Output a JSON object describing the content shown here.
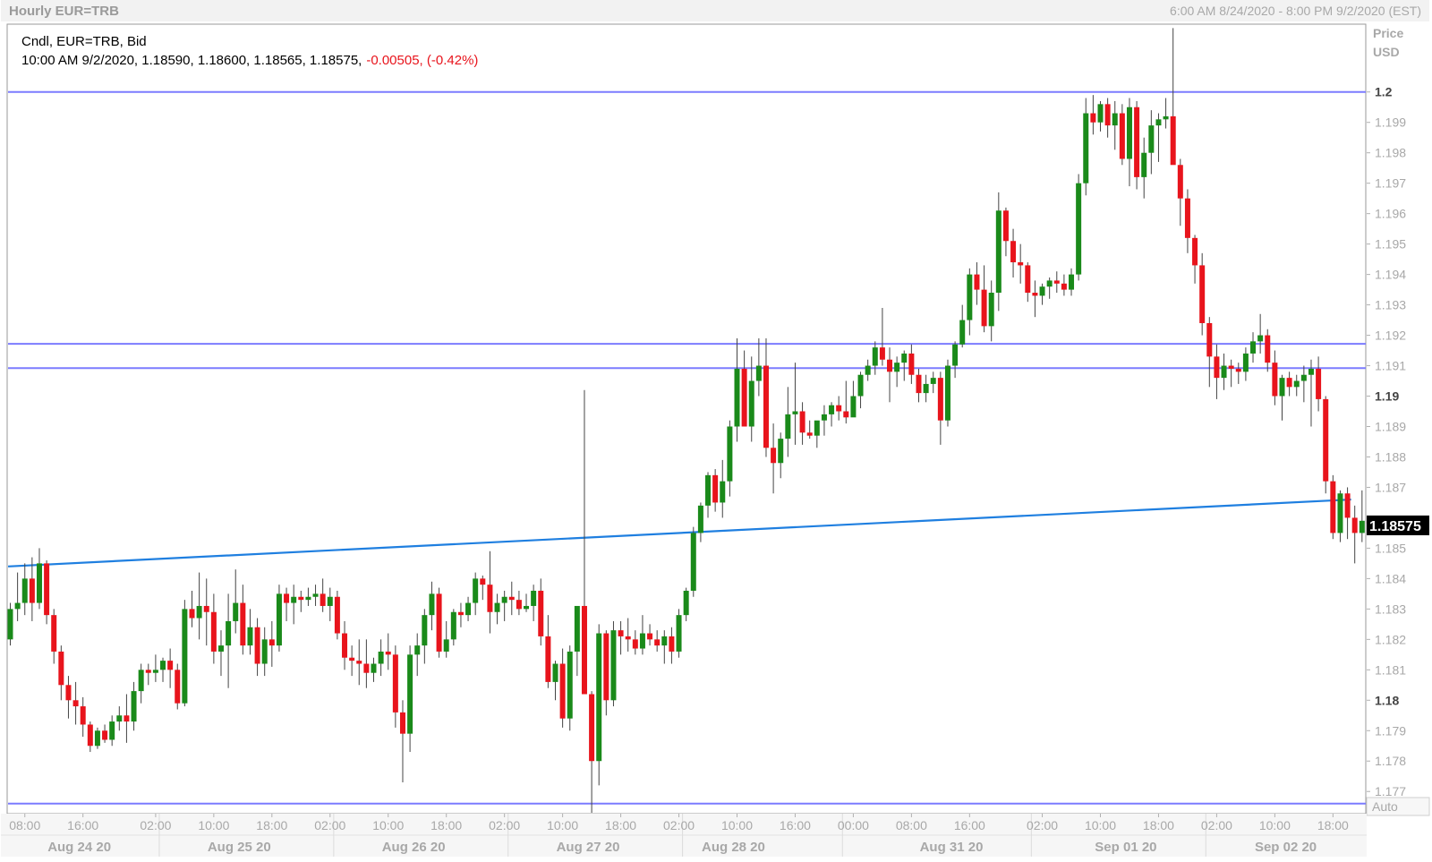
{
  "header": {
    "title": "Hourly EUR=TRB",
    "range": "6:00 AM 8/24/2020 - 8:00 PM 9/2/2020 (EST)"
  },
  "legend": {
    "line1": "Cndl, EUR=TRB, Bid",
    "line2_prefix": "10:00 AM 9/2/2020, 1.18590, 1.18600, 1.18565, 1.18575,",
    "line2_change": "-0.00505, (-0.42%)"
  },
  "price_axis": {
    "title_line1": "Price",
    "title_line2": "USD",
    "auto_label": "Auto"
  },
  "colors": {
    "up": "#1a8a1a",
    "down": "#e8141c",
    "hline": "#7b7bff",
    "trend": "#1f7fe0",
    "change": "#e8141c"
  },
  "chart_data": {
    "type": "candlestick",
    "title": "Hourly EUR=TRB",
    "ylim": [
      1.1763,
      1.2022
    ],
    "y_ticks": [
      {
        "v": 1.2,
        "label": "1.2",
        "bold": true
      },
      {
        "v": 1.199,
        "label": "1.199"
      },
      {
        "v": 1.198,
        "label": "1.198"
      },
      {
        "v": 1.197,
        "label": "1.197"
      },
      {
        "v": 1.196,
        "label": "1.196"
      },
      {
        "v": 1.195,
        "label": "1.195"
      },
      {
        "v": 1.194,
        "label": "1.194"
      },
      {
        "v": 1.193,
        "label": "1.193"
      },
      {
        "v": 1.192,
        "label": "1.192"
      },
      {
        "v": 1.191,
        "label": "1.191"
      },
      {
        "v": 1.19,
        "label": "1.19",
        "bold": true
      },
      {
        "v": 1.189,
        "label": "1.189"
      },
      {
        "v": 1.188,
        "label": "1.188"
      },
      {
        "v": 1.187,
        "label": "1.187"
      },
      {
        "v": 1.185,
        "label": "1.185"
      },
      {
        "v": 1.184,
        "label": "1.184"
      },
      {
        "v": 1.183,
        "label": "1.183"
      },
      {
        "v": 1.182,
        "label": "1.182"
      },
      {
        "v": 1.181,
        "label": "1.181"
      },
      {
        "v": 1.18,
        "label": "1.18",
        "bold": true
      },
      {
        "v": 1.179,
        "label": "1.179"
      },
      {
        "v": 1.178,
        "label": "1.178"
      },
      {
        "v": 1.177,
        "label": "1.177"
      }
    ],
    "last_price": {
      "value": 1.18575,
      "label": "1.18575"
    },
    "hour_ticks": [
      {
        "i": 2,
        "label": "08:00"
      },
      {
        "i": 10,
        "label": "16:00"
      },
      {
        "i": 20,
        "label": "02:00"
      },
      {
        "i": 28,
        "label": "10:00"
      },
      {
        "i": 36,
        "label": "18:00"
      },
      {
        "i": 44,
        "label": "02:00"
      },
      {
        "i": 52,
        "label": "10:00"
      },
      {
        "i": 60,
        "label": "18:00"
      },
      {
        "i": 68,
        "label": "02:00"
      },
      {
        "i": 76,
        "label": "10:00"
      },
      {
        "i": 84,
        "label": "18:00"
      },
      {
        "i": 92,
        "label": "02:00"
      },
      {
        "i": 100,
        "label": "10:00"
      },
      {
        "i": 108,
        "label": "16:00"
      },
      {
        "i": 116,
        "label": "00:00"
      },
      {
        "i": 124,
        "label": "08:00"
      },
      {
        "i": 132,
        "label": "16:00"
      },
      {
        "i": 142,
        "label": "02:00"
      },
      {
        "i": 150,
        "label": "10:00"
      },
      {
        "i": 158,
        "label": "18:00"
      },
      {
        "i": 166,
        "label": "02:00"
      },
      {
        "i": 174,
        "label": "10:00"
      },
      {
        "i": 182,
        "label": "18:00"
      }
    ],
    "day_labels": [
      {
        "i": 9.5,
        "label": "Aug 24 20"
      },
      {
        "i": 31.5,
        "label": "Aug 25 20"
      },
      {
        "i": 55.5,
        "label": "Aug 26 20"
      },
      {
        "i": 79.5,
        "label": "Aug 27 20"
      },
      {
        "i": 99.5,
        "label": "Aug 28 20"
      },
      {
        "i": 129.5,
        "label": "Aug 31 20"
      },
      {
        "i": 153.5,
        "label": "Sep 01 20"
      },
      {
        "i": 175.5,
        "label": "Sep 02 20"
      }
    ],
    "day_separators": [
      21,
      45,
      69,
      93,
      115,
      141,
      165
    ],
    "horizontal_levels": [
      1.2,
      1.19172,
      1.19092,
      1.1766
    ],
    "trendline": {
      "from": {
        "i": -0.3,
        "v": 1.1844
      },
      "to": {
        "i": 184.5,
        "v": 1.1866
      }
    },
    "candles": [
      [
        1.182,
        1.1832,
        1.1818,
        1.183
      ],
      [
        1.183,
        1.1842,
        1.1826,
        1.1832
      ],
      [
        1.1832,
        1.1845,
        1.1828,
        1.184
      ],
      [
        1.184,
        1.1847,
        1.1826,
        1.1832
      ],
      [
        1.1832,
        1.185,
        1.183,
        1.1845
      ],
      [
        1.1845,
        1.1846,
        1.1825,
        1.1828
      ],
      [
        1.1828,
        1.183,
        1.1812,
        1.1816
      ],
      [
        1.1816,
        1.1818,
        1.18,
        1.1805
      ],
      [
        1.1805,
        1.1808,
        1.1794,
        1.18
      ],
      [
        1.18,
        1.1806,
        1.1792,
        1.1798
      ],
      [
        1.1798,
        1.1801,
        1.1788,
        1.1792
      ],
      [
        1.1792,
        1.1793,
        1.1783,
        1.1785
      ],
      [
        1.1785,
        1.1791,
        1.1784,
        1.179
      ],
      [
        1.179,
        1.1792,
        1.1786,
        1.1787
      ],
      [
        1.1787,
        1.1795,
        1.1785,
        1.1793
      ],
      [
        1.1793,
        1.1798,
        1.179,
        1.1795
      ],
      [
        1.1795,
        1.1802,
        1.1786,
        1.1793
      ],
      [
        1.1793,
        1.1806,
        1.179,
        1.1803
      ],
      [
        1.1803,
        1.1812,
        1.1799,
        1.181
      ],
      [
        1.181,
        1.1812,
        1.1805,
        1.1809
      ],
      [
        1.1809,
        1.1815,
        1.1806,
        1.181
      ],
      [
        1.181,
        1.1814,
        1.1806,
        1.1813
      ],
      [
        1.1813,
        1.1817,
        1.1804,
        1.181
      ],
      [
        1.181,
        1.1812,
        1.1797,
        1.1799
      ],
      [
        1.1799,
        1.1833,
        1.1798,
        1.183
      ],
      [
        1.183,
        1.1836,
        1.1824,
        1.1827
      ],
      [
        1.1827,
        1.1842,
        1.182,
        1.1831
      ],
      [
        1.1831,
        1.184,
        1.1818,
        1.1829
      ],
      [
        1.1829,
        1.1835,
        1.1812,
        1.1816
      ],
      [
        1.1816,
        1.1823,
        1.1808,
        1.1818
      ],
      [
        1.1818,
        1.1835,
        1.1804,
        1.1826
      ],
      [
        1.1826,
        1.1843,
        1.1822,
        1.1832
      ],
      [
        1.1832,
        1.1838,
        1.1815,
        1.1818
      ],
      [
        1.1818,
        1.183,
        1.1815,
        1.1824
      ],
      [
        1.1824,
        1.1827,
        1.1808,
        1.1812
      ],
      [
        1.1812,
        1.1824,
        1.1808,
        1.182
      ],
      [
        1.182,
        1.1826,
        1.1811,
        1.1818
      ],
      [
        1.1818,
        1.1838,
        1.1816,
        1.1835
      ],
      [
        1.1835,
        1.1837,
        1.1826,
        1.1832
      ],
      [
        1.1832,
        1.1838,
        1.1825,
        1.1834
      ],
      [
        1.1834,
        1.1836,
        1.1829,
        1.1833
      ],
      [
        1.1833,
        1.1837,
        1.1831,
        1.1834
      ],
      [
        1.1834,
        1.1838,
        1.1831,
        1.1835
      ],
      [
        1.1835,
        1.184,
        1.1829,
        1.1831
      ],
      [
        1.1831,
        1.1837,
        1.1826,
        1.1834
      ],
      [
        1.1834,
        1.1836,
        1.182,
        1.1822
      ],
      [
        1.1822,
        1.1826,
        1.181,
        1.1814
      ],
      [
        1.1814,
        1.1818,
        1.1808,
        1.1813
      ],
      [
        1.1813,
        1.182,
        1.1805,
        1.1812
      ],
      [
        1.1812,
        1.182,
        1.1804,
        1.1809
      ],
      [
        1.1809,
        1.1814,
        1.1806,
        1.1812
      ],
      [
        1.1812,
        1.182,
        1.1808,
        1.1816
      ],
      [
        1.1816,
        1.1822,
        1.181,
        1.1815
      ],
      [
        1.1815,
        1.1818,
        1.1791,
        1.1796
      ],
      [
        1.1796,
        1.18,
        1.1773,
        1.1789
      ],
      [
        1.1789,
        1.1818,
        1.1783,
        1.1815
      ],
      [
        1.1815,
        1.1822,
        1.1808,
        1.1818
      ],
      [
        1.1818,
        1.183,
        1.1812,
        1.1828
      ],
      [
        1.1828,
        1.1839,
        1.1823,
        1.1835
      ],
      [
        1.1835,
        1.1837,
        1.1814,
        1.1816
      ],
      [
        1.1816,
        1.1826,
        1.1814,
        1.182
      ],
      [
        1.182,
        1.183,
        1.1818,
        1.1829
      ],
      [
        1.1829,
        1.1832,
        1.1824,
        1.1828
      ],
      [
        1.1828,
        1.1834,
        1.1826,
        1.1832
      ],
      [
        1.1832,
        1.1842,
        1.1828,
        1.184
      ],
      [
        1.184,
        1.1841,
        1.1833,
        1.1838
      ],
      [
        1.1838,
        1.1849,
        1.1822,
        1.1829
      ],
      [
        1.1829,
        1.1835,
        1.1825,
        1.1832
      ],
      [
        1.1832,
        1.1836,
        1.1826,
        1.1834
      ],
      [
        1.1834,
        1.1839,
        1.1828,
        1.1833
      ],
      [
        1.1833,
        1.1836,
        1.1828,
        1.183
      ],
      [
        1.183,
        1.1835,
        1.1829,
        1.1831
      ],
      [
        1.1831,
        1.1838,
        1.1826,
        1.1836
      ],
      [
        1.1836,
        1.184,
        1.1818,
        1.1821
      ],
      [
        1.1821,
        1.1828,
        1.1804,
        1.1806
      ],
      [
        1.1806,
        1.1813,
        1.18,
        1.1812
      ],
      [
        1.1812,
        1.1817,
        1.1791,
        1.1794
      ],
      [
        1.1794,
        1.1818,
        1.179,
        1.1816
      ],
      [
        1.1816,
        1.1826,
        1.1808,
        1.1831
      ],
      [
        1.1831,
        1.1902,
        1.1813,
        1.1802
      ],
      [
        1.1802,
        1.1803,
        1.1763,
        1.178
      ],
      [
        1.178,
        1.1825,
        1.1772,
        1.1822
      ],
      [
        1.1822,
        1.1823,
        1.1795,
        1.18
      ],
      [
        1.18,
        1.1826,
        1.1798,
        1.1823
      ],
      [
        1.1823,
        1.1826,
        1.1815,
        1.1821
      ],
      [
        1.1821,
        1.1827,
        1.1816,
        1.182
      ],
      [
        1.182,
        1.1823,
        1.1815,
        1.1817
      ],
      [
        1.1817,
        1.1828,
        1.1815,
        1.1822
      ],
      [
        1.1822,
        1.1825,
        1.1818,
        1.182
      ],
      [
        1.182,
        1.1823,
        1.1816,
        1.1818
      ],
      [
        1.1818,
        1.1823,
        1.1812,
        1.1821
      ],
      [
        1.1821,
        1.1824,
        1.1812,
        1.1816
      ],
      [
        1.1816,
        1.183,
        1.1814,
        1.1828
      ],
      [
        1.1828,
        1.1837,
        1.1826,
        1.1836
      ],
      [
        1.1836,
        1.1857,
        1.1834,
        1.1855
      ],
      [
        1.1855,
        1.1865,
        1.1852,
        1.1864
      ],
      [
        1.1864,
        1.1875,
        1.186,
        1.1874
      ],
      [
        1.1874,
        1.1876,
        1.1862,
        1.1865
      ],
      [
        1.1865,
        1.1879,
        1.186,
        1.1872
      ],
      [
        1.1872,
        1.1892,
        1.1867,
        1.189
      ],
      [
        1.189,
        1.1919,
        1.1885,
        1.1909
      ],
      [
        1.1909,
        1.1915,
        1.189,
        1.189
      ],
      [
        1.189,
        1.1913,
        1.1885,
        1.1905
      ],
      [
        1.1905,
        1.1919,
        1.19,
        1.191
      ],
      [
        1.191,
        1.1919,
        1.188,
        1.1883
      ],
      [
        1.1883,
        1.1891,
        1.1868,
        1.1878
      ],
      [
        1.1878,
        1.1888,
        1.1873,
        1.1886
      ],
      [
        1.1886,
        1.1903,
        1.188,
        1.1894
      ],
      [
        1.1894,
        1.1911,
        1.1884,
        1.1895
      ],
      [
        1.1895,
        1.1898,
        1.1884,
        1.1888
      ],
      [
        1.1888,
        1.1892,
        1.1886,
        1.1887
      ],
      [
        1.1887,
        1.1891,
        1.1883,
        1.1892
      ],
      [
        1.1892,
        1.1897,
        1.1887,
        1.1894
      ],
      [
        1.1894,
        1.1898,
        1.189,
        1.1897
      ],
      [
        1.1897,
        1.19,
        1.1892,
        1.1895
      ],
      [
        1.1895,
        1.1905,
        1.1891,
        1.1893
      ],
      [
        1.1893,
        1.1905,
        1.1894,
        1.19
      ],
      [
        1.19,
        1.1908,
        1.1896,
        1.1907
      ],
      [
        1.1907,
        1.1912,
        1.1905,
        1.191
      ],
      [
        1.191,
        1.1918,
        1.1907,
        1.1916
      ],
      [
        1.1916,
        1.1929,
        1.191,
        1.1912
      ],
      [
        1.1912,
        1.1916,
        1.1898,
        1.1908
      ],
      [
        1.1908,
        1.1913,
        1.1903,
        1.1911
      ],
      [
        1.1911,
        1.1915,
        1.1905,
        1.1914
      ],
      [
        1.1914,
        1.1917,
        1.1904,
        1.1907
      ],
      [
        1.1907,
        1.1909,
        1.1898,
        1.1901
      ],
      [
        1.1901,
        1.1907,
        1.1898,
        1.1904
      ],
      [
        1.1904,
        1.1908,
        1.1901,
        1.1906
      ],
      [
        1.1906,
        1.1908,
        1.1884,
        1.1892
      ],
      [
        1.1892,
        1.1912,
        1.189,
        1.191
      ],
      [
        1.191,
        1.1918,
        1.1906,
        1.1917
      ],
      [
        1.1917,
        1.193,
        1.1916,
        1.1925
      ],
      [
        1.1925,
        1.1942,
        1.192,
        1.194
      ],
      [
        1.194,
        1.1944,
        1.193,
        1.1935
      ],
      [
        1.1935,
        1.1943,
        1.1921,
        1.1923
      ],
      [
        1.1923,
        1.1938,
        1.1918,
        1.1934
      ],
      [
        1.1934,
        1.1967,
        1.1928,
        1.1961
      ],
      [
        1.1961,
        1.1962,
        1.1946,
        1.1951
      ],
      [
        1.1951,
        1.1955,
        1.1939,
        1.1944
      ],
      [
        1.1944,
        1.195,
        1.1937,
        1.1943
      ],
      [
        1.1943,
        1.1944,
        1.1931,
        1.1934
      ],
      [
        1.1934,
        1.1938,
        1.1926,
        1.1933
      ],
      [
        1.1933,
        1.1937,
        1.193,
        1.1936
      ],
      [
        1.1936,
        1.1939,
        1.1932,
        1.1938
      ],
      [
        1.1938,
        1.1941,
        1.1934,
        1.1937
      ],
      [
        1.1937,
        1.194,
        1.1933,
        1.1935
      ],
      [
        1.1935,
        1.1942,
        1.1933,
        1.194
      ],
      [
        1.194,
        1.1973,
        1.1938,
        1.197
      ],
      [
        1.197,
        1.1998,
        1.1966,
        1.1993
      ],
      [
        1.1993,
        1.1999,
        1.1986,
        1.199
      ],
      [
        1.199,
        1.1997,
        1.1987,
        1.1996
      ],
      [
        1.1996,
        1.1998,
        1.1985,
        1.1989
      ],
      [
        1.1989,
        1.1997,
        1.1981,
        1.1993
      ],
      [
        1.1993,
        1.1996,
        1.1976,
        1.1978
      ],
      [
        1.1978,
        1.1998,
        1.1969,
        1.1995
      ],
      [
        1.1995,
        1.1997,
        1.1968,
        1.1972
      ],
      [
        1.1972,
        1.1985,
        1.1965,
        1.198
      ],
      [
        1.198,
        1.1994,
        1.1973,
        1.1989
      ],
      [
        1.1989,
        1.1993,
        1.1977,
        1.1991
      ],
      [
        1.1991,
        1.1998,
        1.1988,
        1.1992
      ],
      [
        1.1992,
        1.2021,
        1.1983,
        1.1976
      ],
      [
        1.1976,
        1.1978,
        1.1956,
        1.1965
      ],
      [
        1.1965,
        1.1968,
        1.1947,
        1.1952
      ],
      [
        1.1952,
        1.1953,
        1.1937,
        1.1943
      ],
      [
        1.1943,
        1.1947,
        1.192,
        1.1924
      ],
      [
        1.1924,
        1.1926,
        1.1903,
        1.1913
      ],
      [
        1.1913,
        1.1917,
        1.1899,
        1.1906
      ],
      [
        1.1906,
        1.1914,
        1.1902,
        1.191
      ],
      [
        1.191,
        1.1912,
        1.1903,
        1.1909
      ],
      [
        1.1909,
        1.1911,
        1.1904,
        1.1908
      ],
      [
        1.1908,
        1.1916,
        1.1905,
        1.1914
      ],
      [
        1.1914,
        1.1921,
        1.1911,
        1.1918
      ],
      [
        1.1918,
        1.1927,
        1.1914,
        1.192
      ],
      [
        1.192,
        1.1922,
        1.1908,
        1.1911
      ],
      [
        1.1911,
        1.1915,
        1.1897,
        1.19
      ],
      [
        1.19,
        1.1907,
        1.1892,
        1.1906
      ],
      [
        1.1906,
        1.1908,
        1.19,
        1.1903
      ],
      [
        1.1903,
        1.1907,
        1.19,
        1.1905
      ],
      [
        1.1905,
        1.191,
        1.1898,
        1.1907
      ],
      [
        1.1907,
        1.1912,
        1.189,
        1.1909
      ],
      [
        1.1909,
        1.1913,
        1.1895,
        1.1899
      ],
      [
        1.1899,
        1.19,
        1.1868,
        1.1872
      ],
      [
        1.1872,
        1.1874,
        1.1853,
        1.1855
      ],
      [
        1.1855,
        1.1869,
        1.1852,
        1.1868
      ],
      [
        1.1868,
        1.187,
        1.1853,
        1.186
      ],
      [
        1.186,
        1.1864,
        1.1845,
        1.1855
      ],
      [
        1.1855,
        1.1869,
        1.1852,
        1.1859
      ],
      [
        1.1859,
        1.186,
        1.1856,
        1.1858
      ]
    ]
  }
}
